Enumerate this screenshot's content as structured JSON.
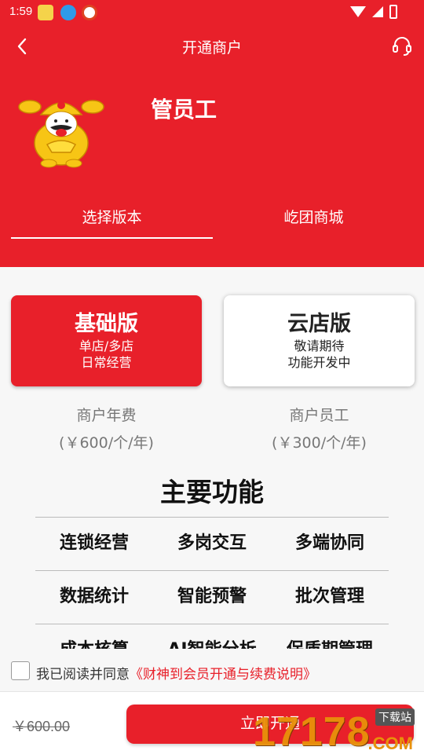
{
  "status_bar": {
    "time": "1:59"
  },
  "header": {
    "title": "开通商户",
    "merchant_name": "管员工",
    "tabs": [
      {
        "label": "选择版本",
        "active": true
      },
      {
        "label": "屹团商城",
        "active": false
      }
    ]
  },
  "plans": [
    {
      "title": "基础版",
      "line1": "单店/多店",
      "line2": "日常经营",
      "selected": true
    },
    {
      "title": "云店版",
      "line1": "敬请期待",
      "line2": "功能开发中",
      "selected": false
    }
  ],
  "fees": [
    {
      "label": "商户年费",
      "price": "(￥600/个/年)"
    },
    {
      "label": "商户员工",
      "price": "(￥300/个/年)"
    }
  ],
  "features": {
    "title": "主要功能",
    "rows": [
      [
        "连锁经营",
        "多岗交互",
        "多端协同"
      ],
      [
        "数据统计",
        "智能预警",
        "批次管理"
      ],
      [
        "成本核算",
        "AI智能分析",
        "保质期管理"
      ]
    ]
  },
  "agreement": {
    "prefix": "我已阅读并同意",
    "link": "《财神到会员开通与续费说明》",
    "checked": false
  },
  "footer": {
    "old_price": "￥600.00",
    "submit_label": "立即开通"
  },
  "watermark": {
    "digits": "17178",
    "tag": "下载站",
    "suffix": ".COM"
  },
  "colors": {
    "brand": "#e8202a",
    "watermark": "#e8910a"
  },
  "icons": {
    "back": "back-arrow-icon",
    "support": "headset-icon"
  }
}
